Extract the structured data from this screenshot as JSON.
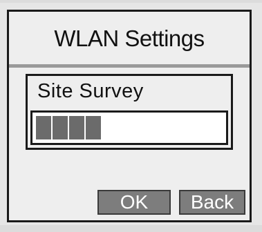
{
  "window": {
    "title": "WLAN Settings"
  },
  "site_survey": {
    "label": "Site Survey",
    "progress": {
      "filled_segments": 4
    }
  },
  "buttons": {
    "ok_label": "OK",
    "back_label": "Back"
  },
  "colors": {
    "background": "#eeeeee",
    "border": "#1a1a1a",
    "progress_fill": "#6b6b6b",
    "button_bg": "#7d7d7d",
    "button_text": "#ffffff",
    "title_rule": "#9a9a9a"
  }
}
